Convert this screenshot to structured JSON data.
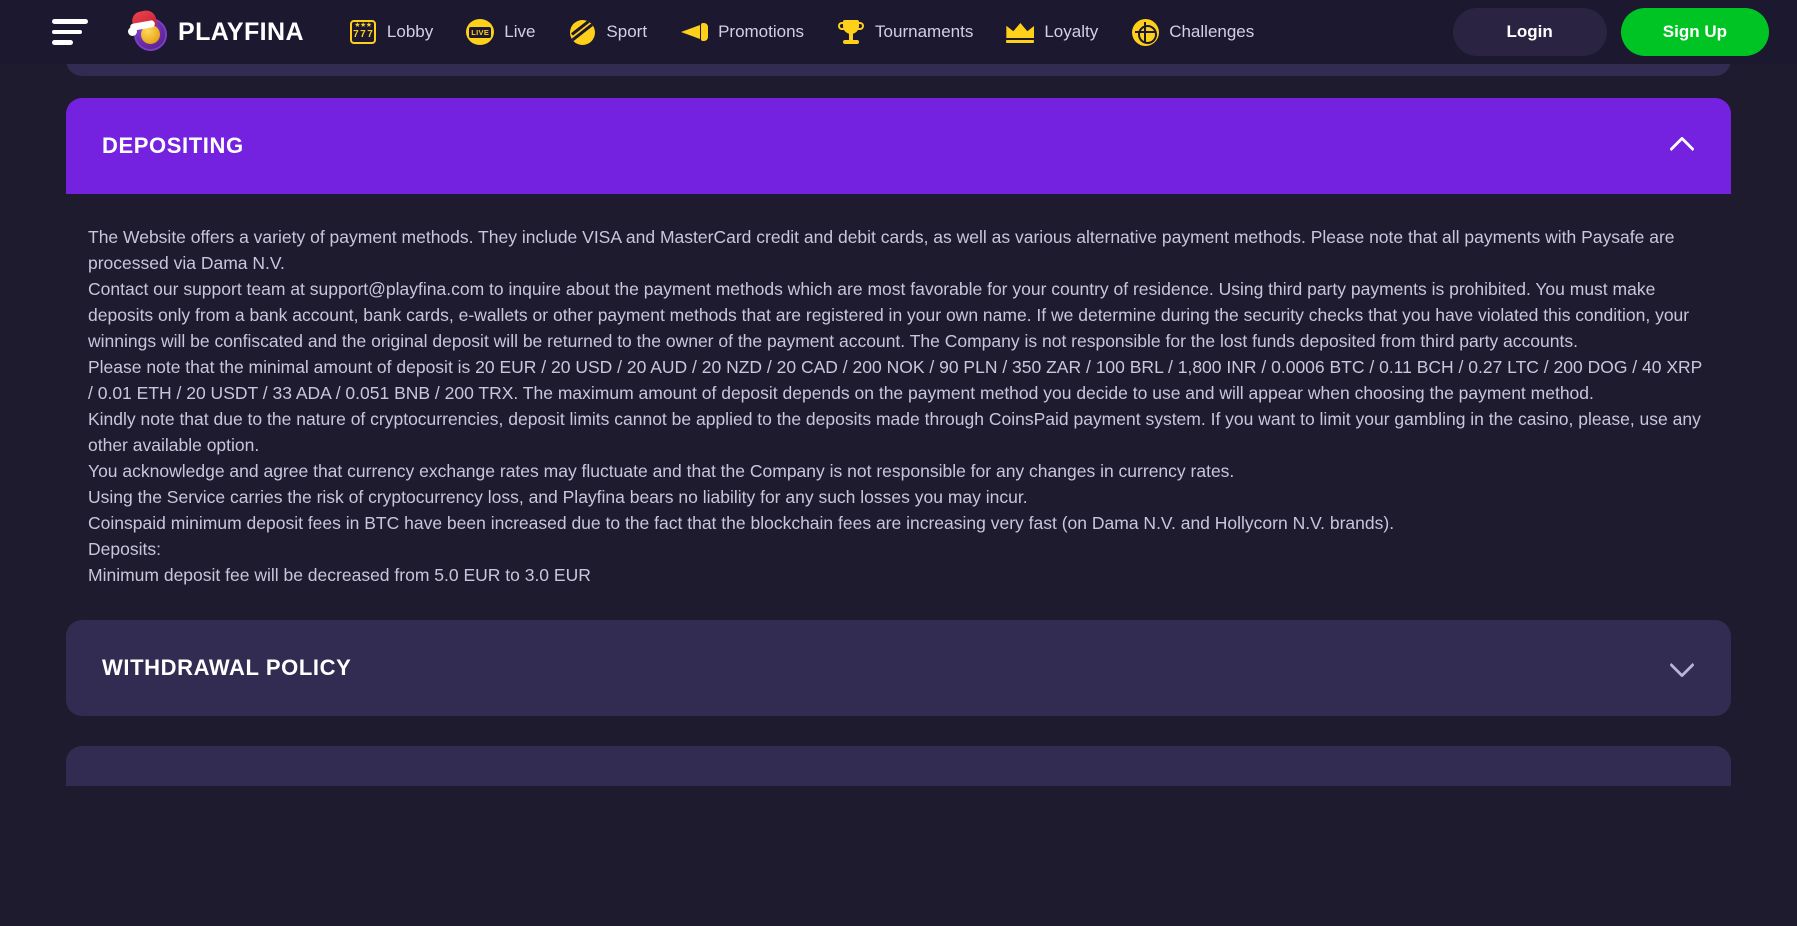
{
  "header": {
    "menu_icon": "hamburger-menu-icon",
    "logo_text": "PLAYFINA",
    "nav": [
      {
        "label": "Lobby",
        "icon": "slot-777-icon"
      },
      {
        "label": "Live",
        "icon": "live-badge-icon"
      },
      {
        "label": "Sport",
        "icon": "sport-ball-icon"
      },
      {
        "label": "Promotions",
        "icon": "megaphone-icon"
      },
      {
        "label": "Tournaments",
        "icon": "trophy-icon"
      },
      {
        "label": "Loyalty",
        "icon": "crown-icon"
      },
      {
        "label": "Challenges",
        "icon": "target-icon"
      }
    ],
    "login_label": "Login",
    "signup_label": "Sign Up"
  },
  "colors": {
    "page_background": "#1e1b2e",
    "header_background": "#1b1830",
    "accordion_open": "#7521e0",
    "accordion_closed": "#332c52",
    "accent_yellow": "#ffd019",
    "signup_green": "#00c423",
    "body_text": "#c9c5dd"
  },
  "accordions": [
    {
      "title": "DEPOSITING",
      "state": "expanded",
      "chevron": "chevron-up-icon",
      "paragraphs": [
        "The Website offers a variety of payment methods. They include VISA and MasterCard credit and debit cards, as well as various alternative payment methods. Please note that all payments with Paysafe are processed via Dama N.V.",
        "Contact our support team at support@playfina.com to inquire about the payment methods which are most favorable for your country of residence. Using third party payments is prohibited. You must make deposits only from a bank account, bank cards, e-wallets or other payment methods that are registered in your own name. If we determine during the security checks that you have violated this condition, your winnings will be confiscated and the original deposit will be returned to the owner of the payment account. The Company is not responsible for the lost funds deposited from third party accounts.",
        "Please note that the minimal amount of deposit is 20 EUR / 20 USD / 20 AUD / 20 NZD / 20 CAD / 200 NOK / 90 PLN / 350 ZAR / 100 BRL / 1,800 INR / 0.0006 BTC / 0.11 BCH / 0.27 LTC / 200 DOG / 40 XRP / 0.01 ETH / 20 USDT / 33 ADA / 0.051 BNB / 200 TRX. The maximum amount of deposit depends on the payment method you decide to use and will appear when choosing the payment method.",
        "Kindly note that due to the nature of cryptocurrencies, deposit limits cannot be applied to the deposits made through CoinsPaid payment system. If you want to limit your gambling in the casino, please, use any other available option.",
        "You acknowledge and agree that currency exchange rates may fluctuate and that the Company is not responsible for any changes in currency rates.",
        "Using the Service carries the risk of cryptocurrency loss, and Playfina bears no liability for any such losses you may incur.",
        "Coinspaid minimum deposit fees in BTC have been increased due to the fact that the blockchain fees are increasing very fast (on Dama N.V. and Hollycorn N.V. brands).",
        "Deposits:",
        "Minimum deposit fee will be decreased from 5.0 EUR to 3.0 EUR"
      ]
    },
    {
      "title": "WITHDRAWAL POLICY",
      "state": "collapsed",
      "chevron": "chevron-down-icon",
      "paragraphs": []
    }
  ]
}
